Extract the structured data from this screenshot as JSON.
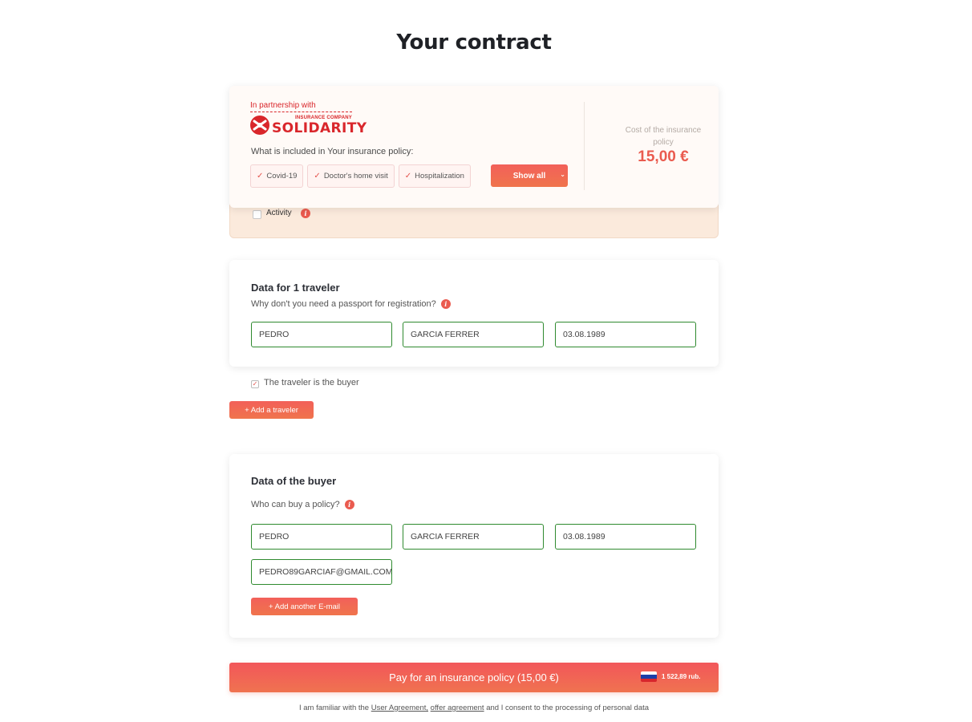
{
  "page": {
    "title": "Your contract"
  },
  "policy": {
    "partnership_text": "In partnership with",
    "logo_small": "INSURANCE COMPANY",
    "logo_big": "SOLIDARITY",
    "included_label": "What is included in Your insurance policy:",
    "coverages": [
      {
        "label": "Covid-19"
      },
      {
        "label": "Doctor's home visit"
      },
      {
        "label": "Hospitalization"
      }
    ],
    "show_all_label": "Show all",
    "cost_label": "Cost of the insurance policy",
    "cost_value": "15,00 €",
    "activity_label": "Activity",
    "activity_checked": false
  },
  "traveler": {
    "title": "Data for 1 traveler",
    "subtitle": "Why don't you need a passport for registration?",
    "first_name": "PEDRO",
    "last_name": "GARCIA FERRER",
    "birth_date": "03.08.1989",
    "is_buyer_label": "The traveler is the buyer",
    "is_buyer_checked": true,
    "add_traveler_label": "+ Add a traveler"
  },
  "buyer": {
    "title": "Data of the buyer",
    "subtitle": "Who can buy a policy?",
    "first_name": "PEDRO",
    "last_name": "GARCIA FERRER",
    "birth_date": "03.08.1989",
    "email": "PEDRO89GARCIAF@GMAIL.COM",
    "add_email_label": "+ Add another E-mail"
  },
  "pay": {
    "label": "Pay for an insurance policy (15,00 €)",
    "rub_amount": "1 522,89 rub.",
    "flag_colors": [
      "#ffffff",
      "#1c3ea8",
      "#d7262c"
    ]
  },
  "agreement": {
    "prefix": "I am familiar with the",
    "user_agreement": "User Agreement,",
    "offer_agreement": "offer agreement",
    "suffix": "and I consent to the processing of personal data"
  },
  "colors": {
    "accent": "#ea5b4f",
    "field_border": "#2f8a2f",
    "brand_red": "#d9262b"
  }
}
